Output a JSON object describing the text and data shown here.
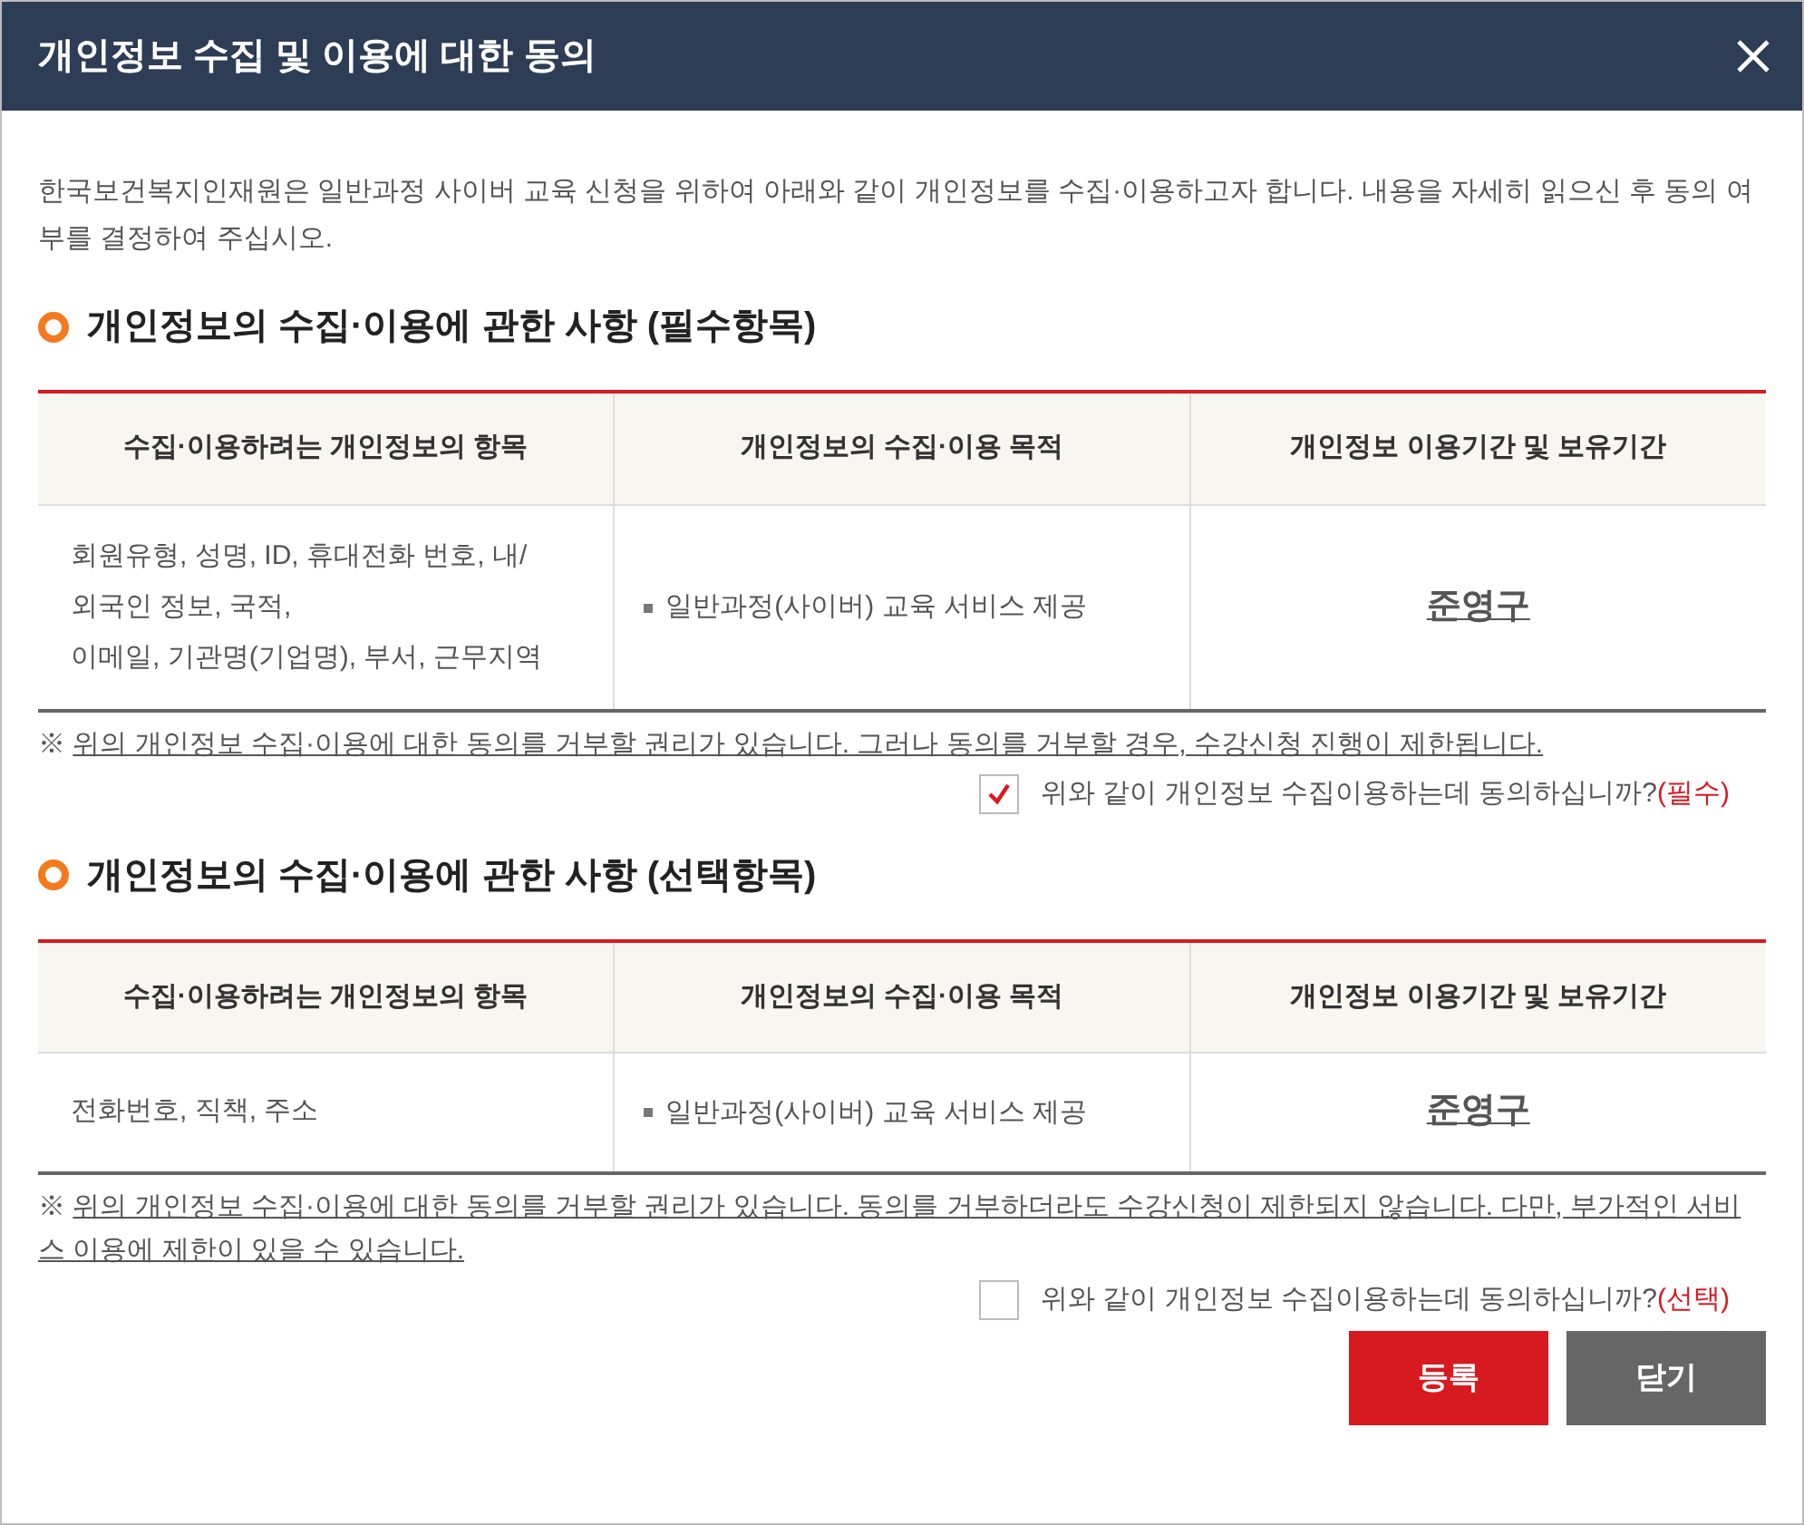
{
  "window": {
    "title": "개인정보 수집 및 이용에 대한 동의"
  },
  "intro": "한국보건복지인재원은 일반과정 사이버 교육 신청을 위하여 아래와 같이 개인정보를 수집·이용하고자 합니다. 내용을 자세히 읽으신 후 동의 여부를 결정하여 주십시오.",
  "sections": [
    {
      "title": "개인정보의 수집·이용에 관한 사항 (필수항목)",
      "columns": [
        "수집·이용하려는 개인정보의 항목",
        "개인정보의 수집·이용 목적",
        "개인정보 이용기간 및 보유기간"
      ],
      "row": {
        "items": [
          "회원유형, 성명, ID, 휴대전화 번호, 내/",
          "외국인 정보, 국적,",
          "이메일, 기관명(기업명), 부서, 근무지역"
        ],
        "purpose": "일반과정(사이버) 교육 서비스 제공",
        "period": "준영구"
      },
      "notice_mark": "※",
      "notice": "위의 개인정보 수집·이용에 대한 동의를 거부할 권리가 있습니다. 그러나 동의를 거부할 경우, 수강신청 진행이 제한됩니다.",
      "agree": {
        "label": "위와 같이 개인정보 수집이용하는데 동의하십니까?",
        "tag": "(필수)",
        "checked": true
      }
    },
    {
      "title": "개인정보의 수집·이용에 관한 사항 (선택항목)",
      "columns": [
        "수집·이용하려는 개인정보의 항목",
        "개인정보의 수집·이용 목적",
        "개인정보 이용기간 및 보유기간"
      ],
      "row": {
        "items": [
          "전화번호, 직책, 주소"
        ],
        "purpose": "일반과정(사이버) 교육 서비스 제공",
        "period": "준영구"
      },
      "notice_mark": "※",
      "notice": "위의 개인정보 수집·이용에 대한 동의를 거부할 권리가 있습니다. 동의를 거부하더라도 수강신청이 제한되지 않습니다. 다만, 부가적인 서비스 이용에 제한이 있을 수 있습니다.",
      "agree": {
        "label": "위와 같이 개인정보 수집이용하는데 동의하십니까?",
        "tag": "(선택)",
        "checked": false
      }
    }
  ],
  "buttons": [
    {
      "label": "등록",
      "kind": "primary"
    },
    {
      "label": "닫기",
      "kind": "secondary"
    }
  ]
}
